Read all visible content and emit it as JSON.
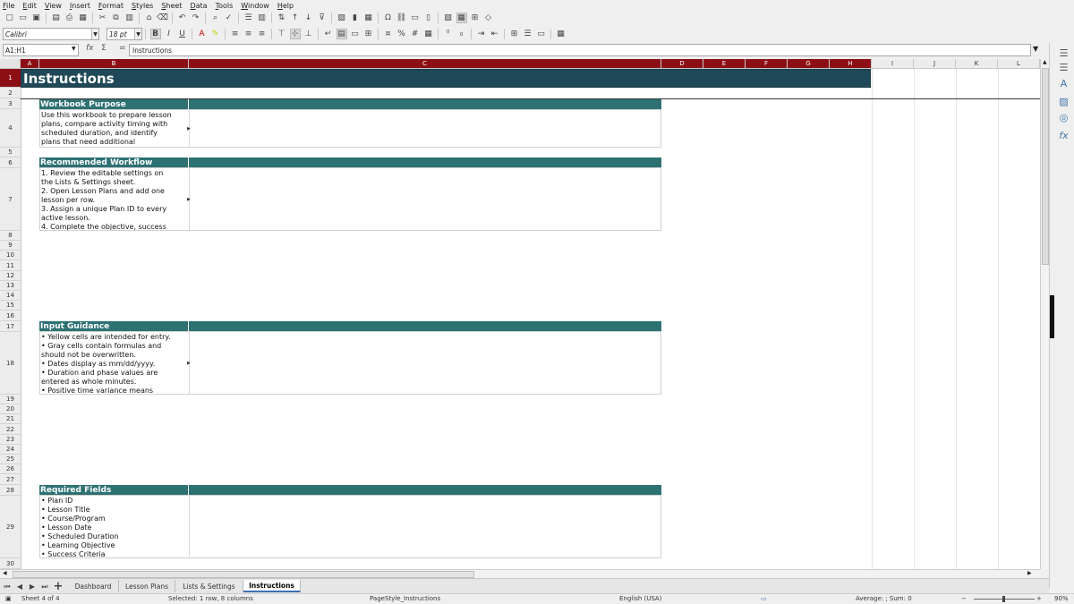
{
  "menu": [
    "File",
    "Edit",
    "View",
    "Insert",
    "Format",
    "Styles",
    "Sheet",
    "Data",
    "Tools",
    "Window",
    "Help"
  ],
  "toolbar": {
    "font_name": "Calibri",
    "font_size": "18 pt"
  },
  "formula_bar": {
    "name_box": "A1:H1",
    "content": "Instructions"
  },
  "columns": [
    "A",
    "B",
    "C",
    "D",
    "E",
    "F",
    "G",
    "H",
    "I",
    "J",
    "K",
    "L"
  ],
  "rows": [
    "1",
    "2",
    "3",
    "4",
    "5",
    "6",
    "7",
    "8",
    "9",
    "10",
    "11",
    "12",
    "13",
    "14",
    "15",
    "16",
    "17",
    "18",
    "19",
    "20",
    "21",
    "22",
    "23",
    "24",
    "25",
    "26",
    "27",
    "28",
    "29",
    "30"
  ],
  "sheet": {
    "title": "Instructions",
    "sections": [
      {
        "header": "Workbook Purpose",
        "lines": [
          "Use this workbook to prepare lesson",
          "plans, compare activity timing with",
          "scheduled duration, and identify",
          "plans that need additional"
        ]
      },
      {
        "header": "Recommended Workflow",
        "lines": [
          "1. Review the editable settings on",
          "the Lists & Settings sheet.",
          "2. Open Lesson Plans and add one",
          "lesson per row.",
          "3. Assign a unique Plan ID to every",
          "active lesson.",
          "4. Complete the objective, success"
        ]
      },
      {
        "header": "Input Guidance",
        "lines": [
          "• Yellow cells are intended for entry.",
          "• Gray cells contain formulas and",
          "should not be overwritten.",
          "• Dates display as mm/dd/yyyy.",
          "• Duration and phase values are",
          "entered as whole minutes.",
          "• Positive time variance means"
        ]
      },
      {
        "header": "Required Fields",
        "lines": [
          "• Plan ID",
          "• Lesson Title",
          "• Course/Program",
          "• Lesson Date",
          "• Scheduled Duration",
          "• Learning Objective",
          "• Success Criteria"
        ]
      }
    ]
  },
  "tabs": [
    "Dashboard",
    "Lesson Plans",
    "Lists & Settings",
    "Instructions"
  ],
  "active_tab": "Instructions",
  "status": {
    "sheet": "Sheet 4 of 4",
    "selection": "Selected: 1 row, 8 columns",
    "page_style": "PageStyle_Instructions",
    "language": "English (USA)",
    "summary": "Average: ; Sum: 0",
    "zoom": "90%"
  },
  "colors": {
    "title_fill": "#1f4958",
    "section_fill": "#2e7173",
    "selected_header": "#8c0f15"
  }
}
